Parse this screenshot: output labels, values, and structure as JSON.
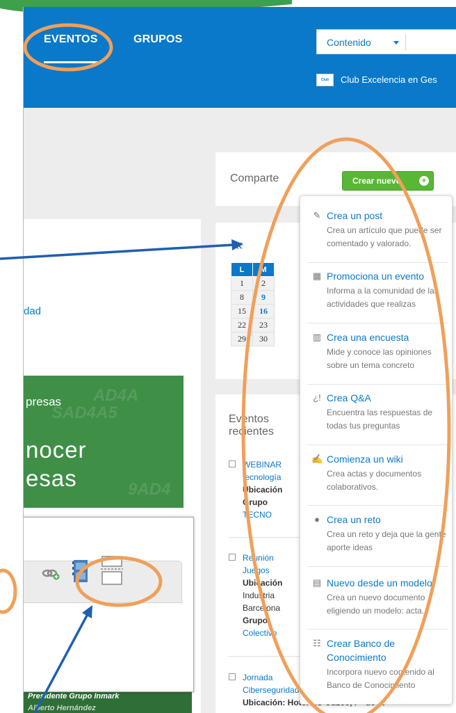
{
  "nav": {
    "eventos": "EVENTOS",
    "grupos": "GRUPOS"
  },
  "search": {
    "scope": "Contenido"
  },
  "community": {
    "logo_text": "Club",
    "name": "Club Excelencia en Ges"
  },
  "left": {
    "link_fragment": "dad",
    "banner_line1": "presas",
    "banner_line2": "nocer",
    "banner_line3": "esas",
    "banner_bottom1": "Presidente Grupo Inmark",
    "banner_bottom2": "Alberto Hernández"
  },
  "comparte": {
    "label": "Comparte",
    "button": "Crear nuevo",
    "button_plus": "+"
  },
  "calendar": {
    "prev": "«",
    "headers": [
      "L",
      "M"
    ],
    "rows": [
      [
        "1",
        "2"
      ],
      [
        "8",
        "9"
      ],
      [
        "15",
        "16"
      ],
      [
        "22",
        "23"
      ],
      [
        "29",
        "30"
      ]
    ],
    "linked": [
      "9",
      "16"
    ]
  },
  "events": {
    "title": "Eventos recientes",
    "items": [
      {
        "line1": "WEBINAR",
        "line2": "tecnología",
        "line3": "Ubicación",
        "line4": "Grupo",
        "line5": "TECNO"
      },
      {
        "line1": "Reunión",
        "line2": "Juegos",
        "line3": "Ubicación",
        "line4": "Industria",
        "line5": "Barcelona",
        "line6": "Grupo",
        "line7": "Colectivo"
      },
      {
        "line1": "Jornada",
        "line2": "Ciberseguridad",
        "line3": "Ubicación: Hotel AC Cuzco, Pº de la"
      }
    ]
  },
  "menu": {
    "items": [
      {
        "title": "Crea un post",
        "desc": "Crea un artículo que puede ser comentado y valorado.",
        "icon": "pencil-icon"
      },
      {
        "title": "Promociona un evento",
        "desc": "Informa a la comunidad de las actividades que realizas",
        "icon": "calendar-icon"
      },
      {
        "title": "Crea una encuesta",
        "desc": "Mide y conoce las opiniones sobre un tema concreto",
        "icon": "bar-chart-icon"
      },
      {
        "title": "Crea Q&A",
        "desc": "Encuentra las respuestas de todas tus preguntas",
        "icon": "question-icon"
      },
      {
        "title": "Comienza un wiki",
        "desc": "Crea actas y documentos colaborativos.",
        "icon": "edit-icon"
      },
      {
        "title": "Crea un reto",
        "desc": "Crea un reto y deja que la gente aporte ideas",
        "icon": "lightbulb-icon"
      },
      {
        "title": "Nuevo desde un modelo",
        "desc": "Crea un nuevo documento eligiendo un modelo: acta...",
        "icon": "template-icon"
      },
      {
        "title": "Crear Banco de Conocimiento",
        "desc": "Incorpora nuevo contenido al Banco de Conocimiento",
        "icon": "knowledge-icon"
      }
    ]
  },
  "colors": {
    "brand_blue": "#0a79c9",
    "green": "#58b734",
    "annotation_orange": "#f0a05a",
    "arrow_blue": "#1f5fb0"
  }
}
